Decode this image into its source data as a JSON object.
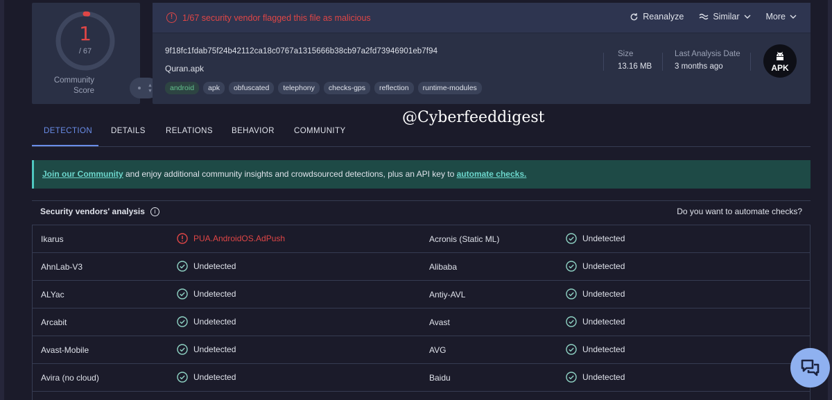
{
  "score": {
    "detections": "1",
    "total": "/ 67",
    "community_label_line1": "Community",
    "community_label_line2": "Score",
    "ratio": 0.0149
  },
  "alert": {
    "text": "1/67 security vendor flagged this file as malicious",
    "color": "#e04646"
  },
  "actions": {
    "reanalyze": "Reanalyze",
    "similar": "Similar",
    "more": "More"
  },
  "file": {
    "hash": "9f18fc1fdab75f24b42112ca18c0767a1315666b38cb97a2fd73946901eb7f94",
    "name": "Quran.apk",
    "tags": [
      "android",
      "apk",
      "obfuscated",
      "telephony",
      "checks-gps",
      "reflection",
      "runtime-modules"
    ],
    "size_label": "Size",
    "size_value": "13.16 MB",
    "last_analysis_label": "Last Analysis Date",
    "last_analysis_value": "3 months ago",
    "type_badge": "APK"
  },
  "tabs": [
    "DETECTION",
    "DETAILS",
    "RELATIONS",
    "BEHAVIOR",
    "COMMUNITY"
  ],
  "watermark": "@Cyberfeeddigest",
  "banner": {
    "link1": "Join our Community",
    "middle": " and enjoy additional community insights and crowdsourced detections, plus an API key to ",
    "link2": "automate checks."
  },
  "vendors_header": {
    "title": "Security vendors' analysis",
    "right": "Do you want to automate checks?"
  },
  "vendors": [
    {
      "left": "Ikarus",
      "left_result": "PUA.AndroidOS.AdPush",
      "left_malicious": true,
      "right": "Acronis (Static ML)",
      "right_result": "Undetected"
    },
    {
      "left": "AhnLab-V3",
      "left_result": "Undetected",
      "left_malicious": false,
      "right": "Alibaba",
      "right_result": "Undetected"
    },
    {
      "left": "ALYac",
      "left_result": "Undetected",
      "left_malicious": false,
      "right": "Antiy-AVL",
      "right_result": "Undetected"
    },
    {
      "left": "Arcabit",
      "left_result": "Undetected",
      "left_malicious": false,
      "right": "Avast",
      "right_result": "Undetected"
    },
    {
      "left": "Avast-Mobile",
      "left_result": "Undetected",
      "left_malicious": false,
      "right": "AVG",
      "right_result": "Undetected"
    },
    {
      "left": "Avira (no cloud)",
      "left_result": "Undetected",
      "left_malicious": false,
      "right": "Baidu",
      "right_result": "Undetected"
    }
  ],
  "colors": {
    "accent": "#6a8de8",
    "malicious": "#e04646",
    "clean": "#8fd3c4",
    "banner": "#1e4a46"
  }
}
